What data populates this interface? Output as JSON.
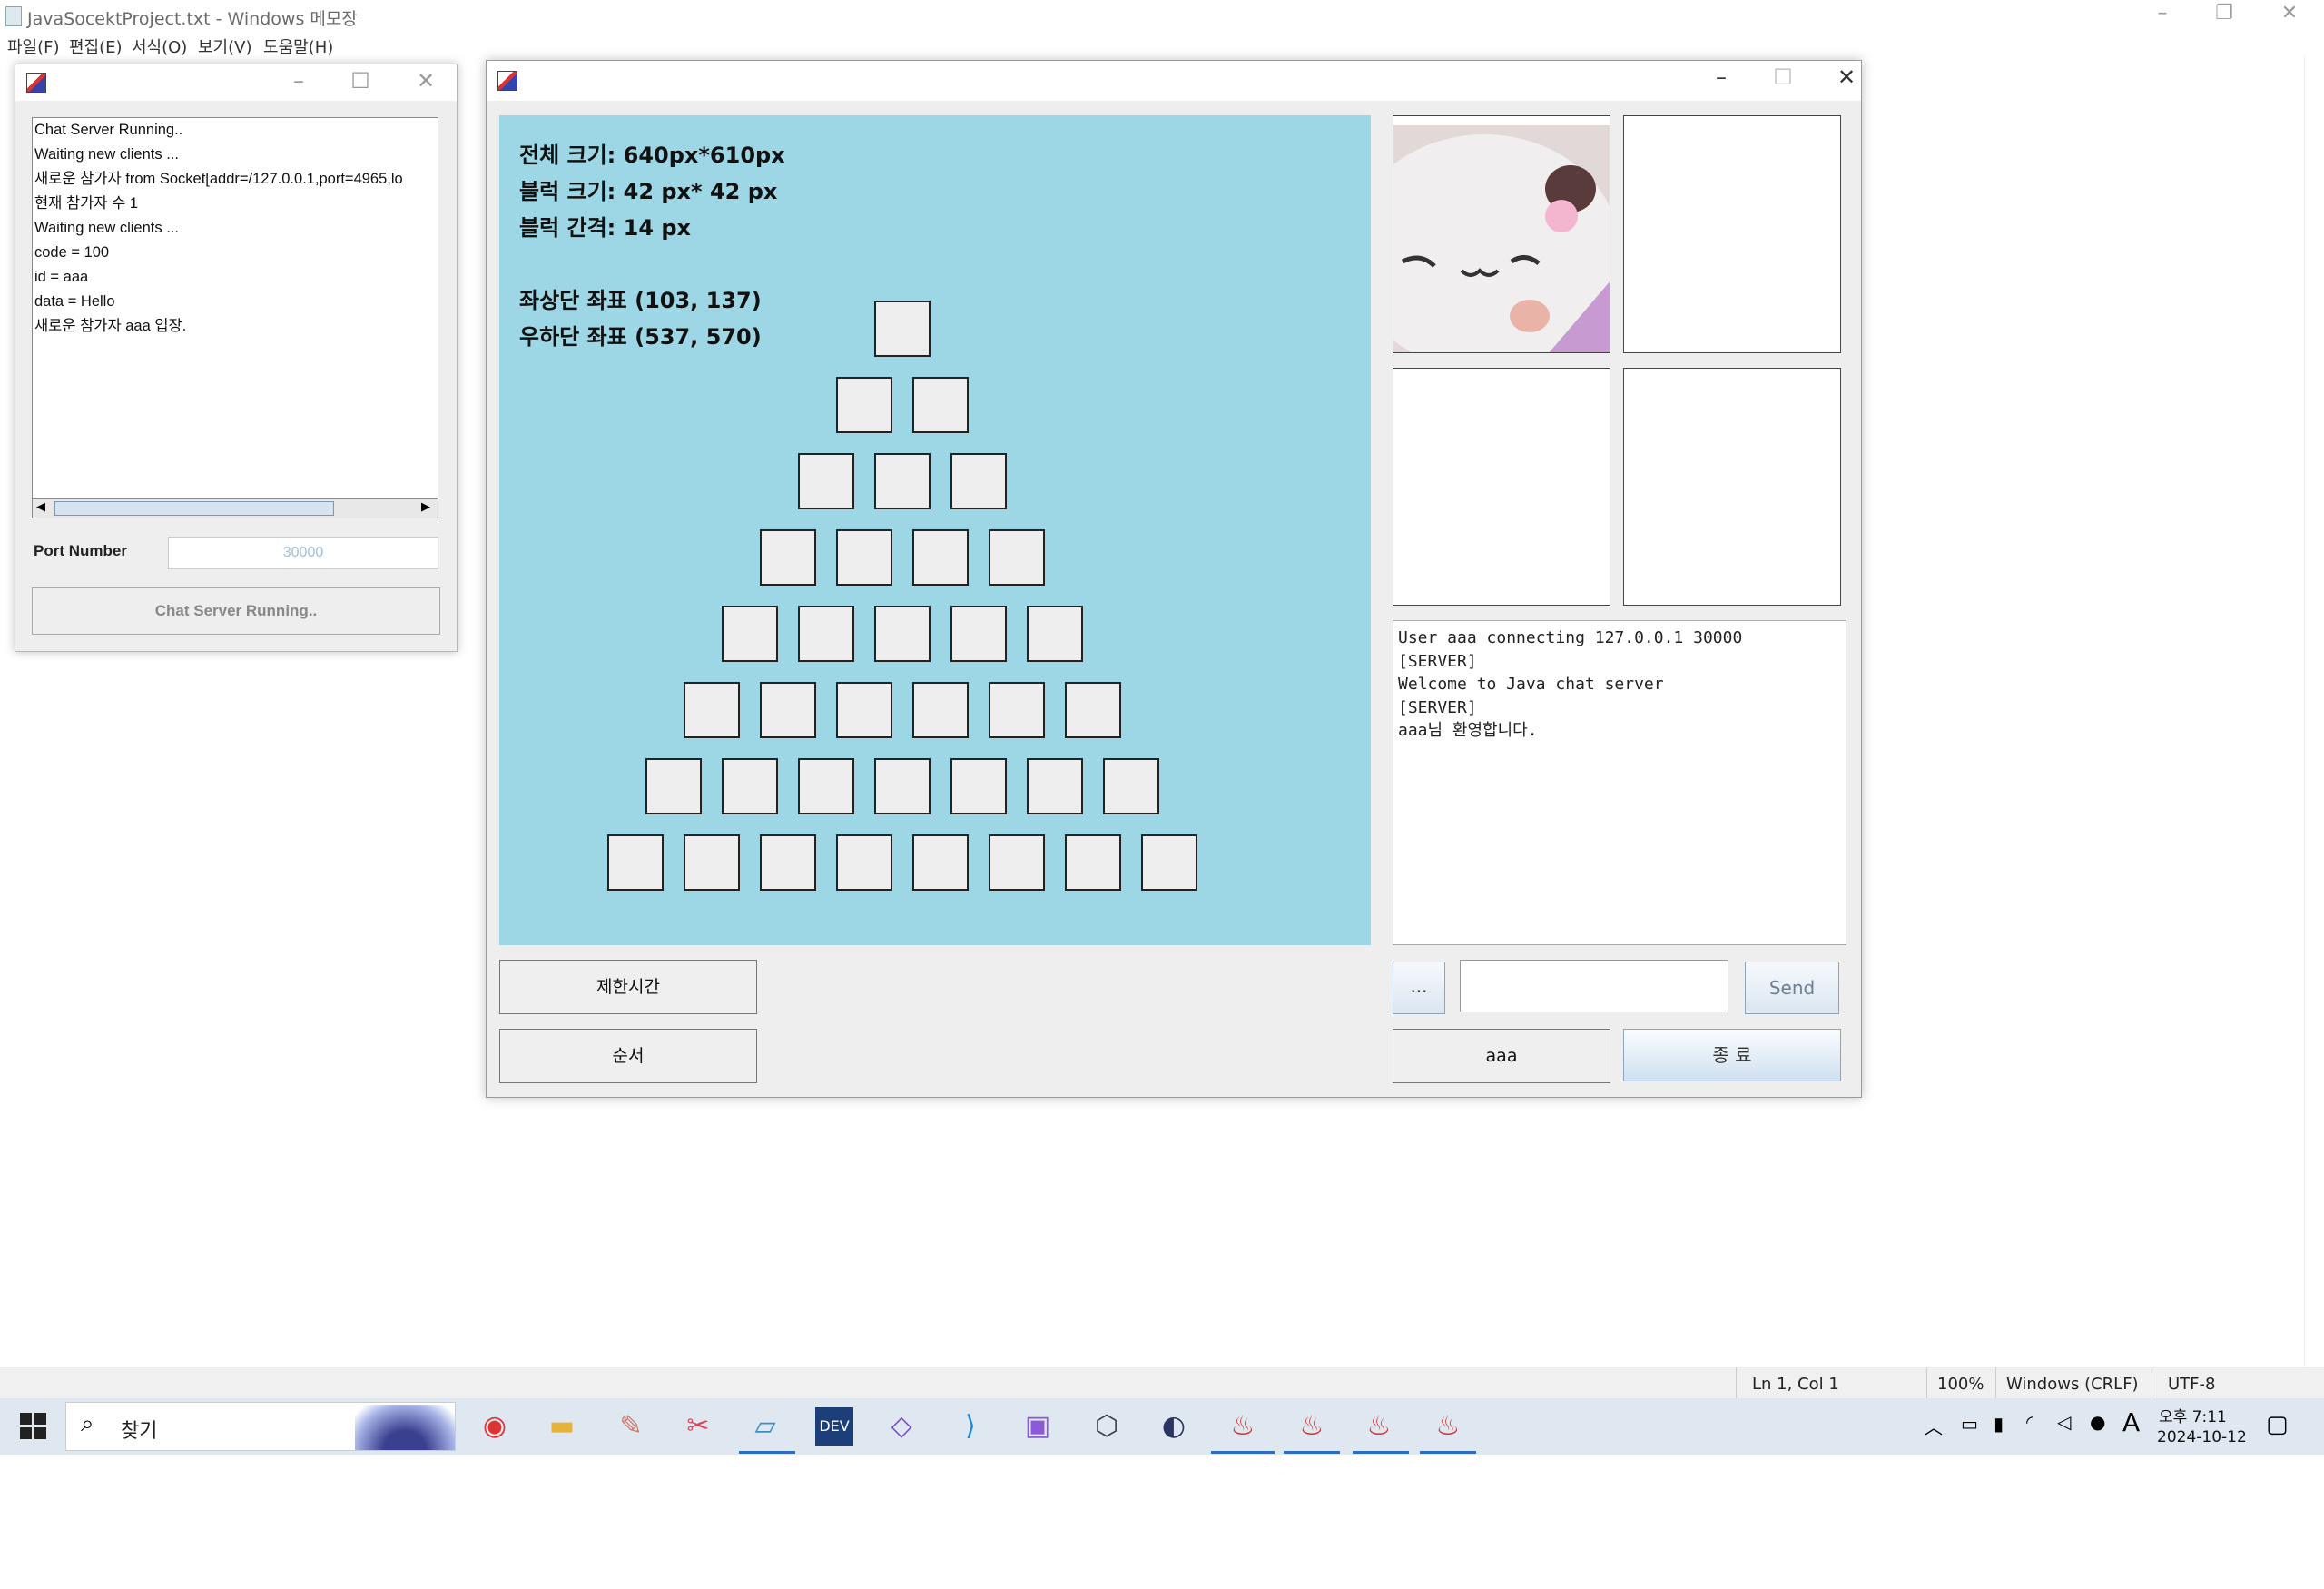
{
  "notepad": {
    "title": "JavaSocektProject.txt - Windows 메모장",
    "menu": [
      "파일(F)",
      "편집(E)",
      "서식(O)",
      "보기(V)",
      "도움말(H)"
    ],
    "status": {
      "position": "Ln 1, Col 1",
      "zoom": "100%",
      "line_ending": "Windows (CRLF)",
      "encoding": "UTF-8"
    }
  },
  "server": {
    "log": [
      "Chat Server Running..",
      "Waiting new clients ...",
      "새로운 참가자 from Socket[addr=/127.0.0.1,port=4965,lo",
      "현재 참가자 수 1",
      "Waiting new clients ...",
      "code = 100",
      "id = aaa",
      "data = Hello",
      "새로운 참가자 aaa 입장."
    ],
    "port_label": "Port Number",
    "port_value": "30000",
    "status_button": "Chat Server Running.."
  },
  "game": {
    "info": {
      "total_size": "전체 크기: 640px*610px",
      "block_size": "블럭 크기: 42 px* 42 px",
      "block_gap": "블럭 간격: 14 px",
      "top_left": "좌상단 좌표 (103, 137)",
      "bottom_right": "우하단 좌표 (537, 570)"
    },
    "pyramid_rows": [
      1,
      2,
      3,
      4,
      5,
      6,
      7,
      8
    ],
    "chat_log": [
      "User aaa connecting 127.0.0.1 30000",
      "[SERVER]",
      "Welcome to Java chat server",
      "[SERVER]",
      "aaa님 환영합니다."
    ],
    "time_limit_button": "제한시간",
    "order_button": "순서",
    "dots_button": "...",
    "send_button": "Send",
    "message_input": "",
    "user_button": "aaa",
    "exit_button": "종 료"
  },
  "taskbar": {
    "search_label": "찾기",
    "time": "오후 7:11",
    "date": "2024-10-12",
    "ime": "A"
  }
}
